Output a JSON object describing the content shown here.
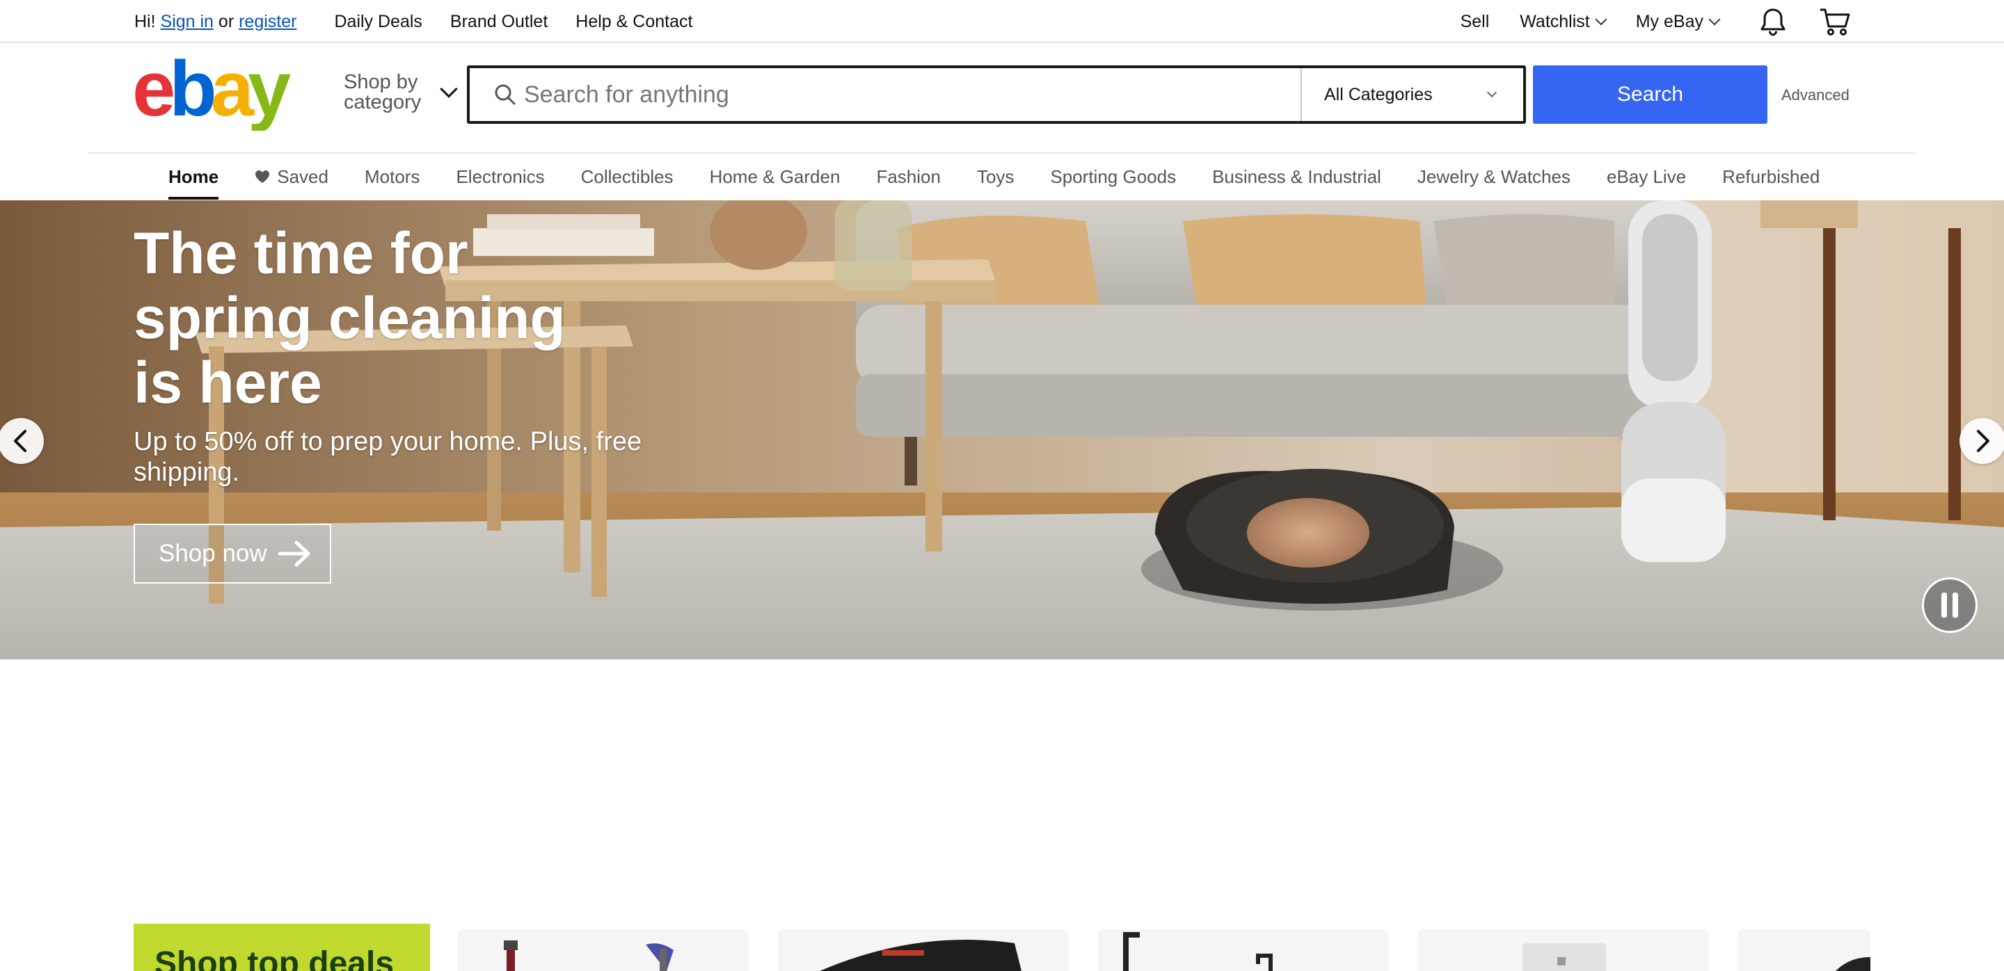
{
  "topbar": {
    "greeting": "Hi!",
    "sign_in": "Sign in",
    "or": "or",
    "register": "register",
    "daily_deals": "Daily Deals",
    "brand_outlet": "Brand Outlet",
    "help_contact": "Help & Contact",
    "sell": "Sell",
    "watchlist": "Watchlist",
    "my_ebay": "My eBay"
  },
  "header": {
    "logo_text": "ebay",
    "shop_by_category": "Shop by category",
    "search_placeholder": "Search for anything",
    "category_selected": "All Categories",
    "search_button": "Search",
    "advanced": "Advanced"
  },
  "catnav": {
    "items": [
      {
        "label": "Home",
        "active": true
      },
      {
        "label": "Saved"
      },
      {
        "label": "Motors"
      },
      {
        "label": "Electronics"
      },
      {
        "label": "Collectibles"
      },
      {
        "label": "Home & Garden"
      },
      {
        "label": "Fashion"
      },
      {
        "label": "Toys"
      },
      {
        "label": "Sporting Goods"
      },
      {
        "label": "Business & Industrial"
      },
      {
        "label": "Jewelry & Watches"
      },
      {
        "label": "eBay Live"
      },
      {
        "label": "Refurbished"
      }
    ]
  },
  "hero": {
    "headline": "The time for spring cleaning is here",
    "subtext": "Up to 50% off to prep your home. Plus, free shipping.",
    "cta": "Shop now"
  },
  "deals": {
    "promo_label": "Shop top deals"
  },
  "colors": {
    "search_blue": "#3665f3",
    "link_blue": "#0654ba",
    "deals_green": "#c1d82f",
    "logo_red": "#e53238",
    "logo_blue": "#0064d2",
    "logo_yellow": "#f5af02",
    "logo_green": "#86b817"
  },
  "icons": [
    "bell-icon",
    "cart-icon",
    "search-icon",
    "heart-icon",
    "arrow-right-icon",
    "chevron-left-icon",
    "chevron-right-icon",
    "pause-icon"
  ]
}
